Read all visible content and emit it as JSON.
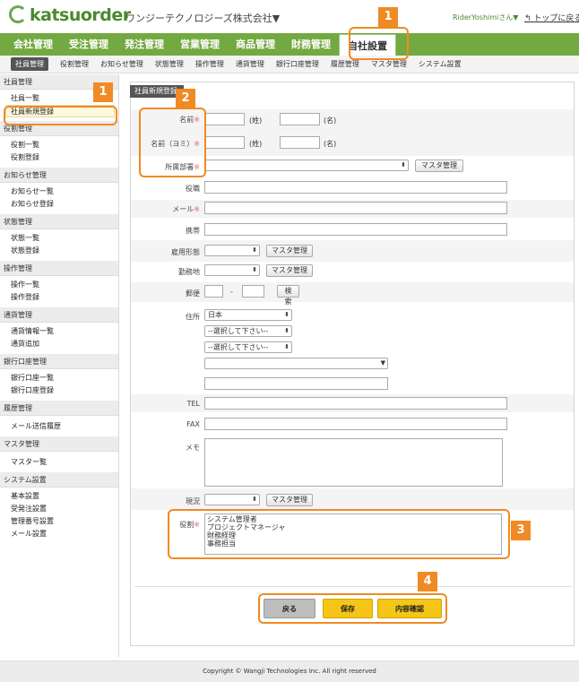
{
  "header": {
    "logo": "katsuorder",
    "company": "ワンジーテクノロジーズ株式会社▼",
    "user": "RiderYoshimiさん▼",
    "toplink": "トップに戻る"
  },
  "main_nav": [
    "会社管理",
    "受注管理",
    "発注管理",
    "営業管理",
    "商品管理",
    "財務管理",
    "自社設置"
  ],
  "sub_nav": [
    "社員管理",
    "役割管理",
    "お知らせ管理",
    "状態管理",
    "操作管理",
    "通貨管理",
    "銀行口座管理",
    "履歴管理",
    "マスタ管理",
    "システム設置"
  ],
  "sidebar": [
    {
      "group": "社員管理",
      "items": [
        "社員一覧",
        "社員新規登録"
      ]
    },
    {
      "group": "役割管理",
      "items": [
        "役割一覧",
        "役割登録"
      ]
    },
    {
      "group": "お知らせ管理",
      "items": [
        "お知らせ一覧",
        "お知らせ登録"
      ]
    },
    {
      "group": "状態管理",
      "items": [
        "状態一覧",
        "状態登録"
      ]
    },
    {
      "group": "操作管理",
      "items": [
        "操作一覧",
        "操作登録"
      ]
    },
    {
      "group": "通貨管理",
      "items": [
        "通貨情報一覧",
        "通貨追加"
      ]
    },
    {
      "group": "銀行口座管理",
      "items": [
        "銀行口座一覧",
        "銀行口座登録"
      ]
    },
    {
      "group": "履歴管理",
      "items": [
        "メール送信履歴"
      ]
    },
    {
      "group": "マスタ管理",
      "items": [
        "マスター覧"
      ]
    },
    {
      "group": "システム設置",
      "items": [
        "基本設置",
        "受発注設置",
        "管理番号設置",
        "メール設置"
      ]
    }
  ],
  "content_tab": "社員新規登録",
  "form": {
    "name_label": "名前",
    "kana_label": "名前（ヨミ）",
    "last": "(姓)",
    "first": "(名)",
    "dept_label": "所属部署",
    "master_btn": "マスタ管理",
    "title_label": "役職",
    "mail_label": "メール",
    "mobile_label": "携帯",
    "employ_label": "雇用形態",
    "work_label": "勤務地",
    "zip_label": "郵便",
    "zip_sep": "-",
    "search_btn": "検索",
    "addr_label": "住所",
    "country": "日本",
    "select_prompt": "--選択して下さい--",
    "tel_label": "TEL",
    "fax_label": "FAX",
    "memo_label": "メモ",
    "status_label": "現況",
    "role_label": "役割",
    "roles": [
      "システム管理者",
      "プロジェクトマネージャ",
      "財務経理",
      "事務担当"
    ],
    "req_mark": "※"
  },
  "buttons": {
    "back": "戻る",
    "save": "保存",
    "confirm": "内容確認"
  },
  "callouts": [
    "1",
    "1",
    "2",
    "3",
    "4"
  ],
  "footer": "Copyright © Wangji Technologies Inc. All right reserved",
  "colors": {
    "nav_green": "#72a940",
    "callout": "#f08a24",
    "button_yellow": "#f5c518"
  }
}
